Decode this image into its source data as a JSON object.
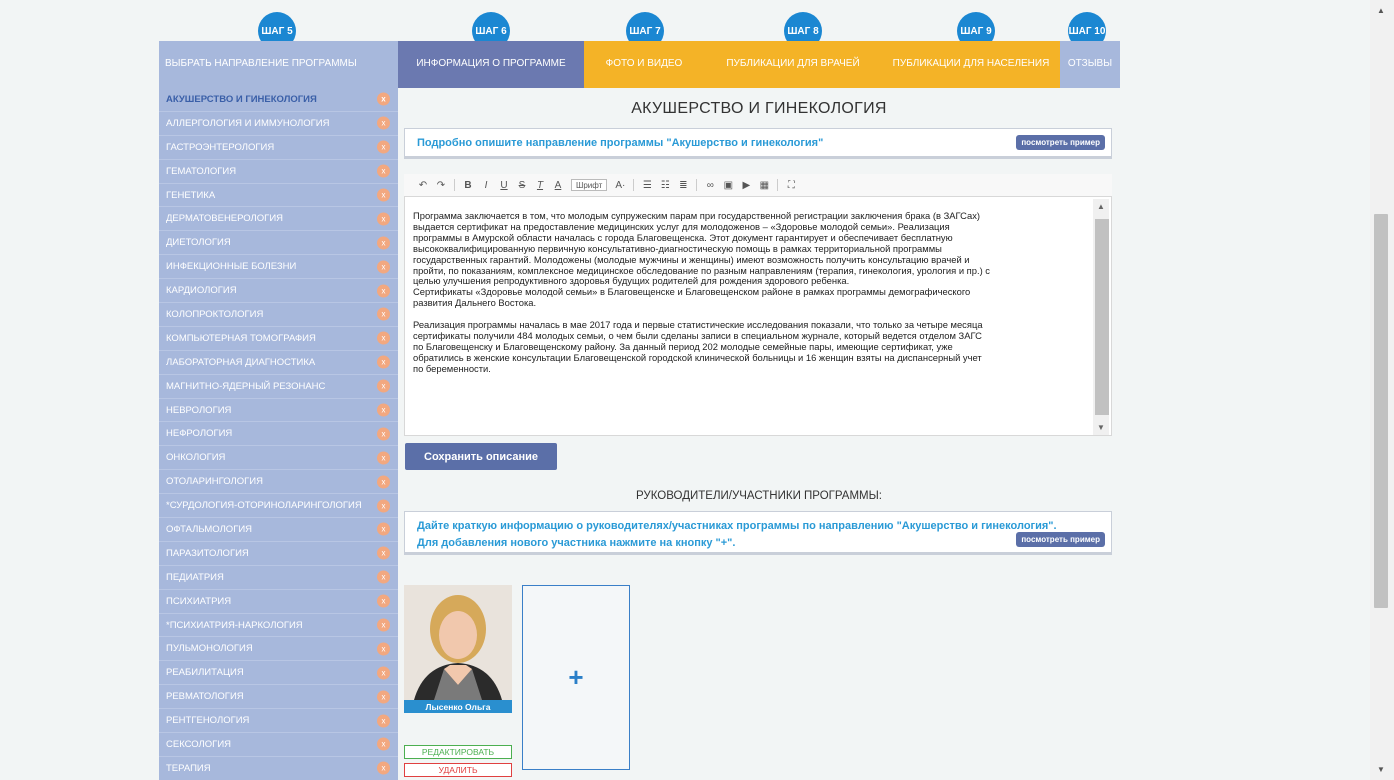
{
  "steps": [
    {
      "label": "ШАГ 5"
    },
    {
      "label": "ШАГ 6"
    },
    {
      "label": "ШАГ 7"
    },
    {
      "label": "ШАГ 8"
    },
    {
      "label": "ШАГ 9"
    },
    {
      "label": "ШАГ 10"
    }
  ],
  "step_bars": {
    "choose_direction": "ВЫБРАТЬ НАПРАВЛЕНИЕ ПРОГРАММЫ",
    "program_info": "ИНФОРМАЦИЯ О ПРОГРАММЕ",
    "photo_video": "ФОТО И ВИДЕО",
    "pub_doctors": "ПУБЛИКАЦИИ ДЛЯ ВРАЧЕЙ",
    "pub_population": "ПУБЛИКАЦИИ ДЛЯ НАСЕЛЕНИЯ",
    "reviews": "ОТЗЫВЫ"
  },
  "sidebar": {
    "items": [
      "АКУШЕРСТВО И ГИНЕКОЛОГИЯ",
      "АЛЛЕРГОЛОГИЯ И ИММУНОЛОГИЯ",
      "ГАСТРОЭНТЕРОЛОГИЯ",
      "ГЕМАТОЛОГИЯ",
      "ГЕНЕТИКА",
      "ДЕРМАТОВЕНЕРОЛОГИЯ",
      "ДИЕТОЛОГИЯ",
      "ИНФЕКЦИОННЫЕ БОЛЕЗНИ",
      "КАРДИОЛОГИЯ",
      "КОЛОПРОКТОЛОГИЯ",
      "КОМПЬЮТЕРНАЯ ТОМОГРАФИЯ",
      "ЛАБОРАТОРНАЯ ДИАГНОСТИКА",
      "МАГНИТНО-ЯДЕРНЫЙ РЕЗОНАНС",
      "НЕВРОЛОГИЯ",
      "НЕФРОЛОГИЯ",
      "ОНКОЛОГИЯ",
      "ОТОЛАРИНГОЛОГИЯ",
      "*СУРДОЛОГИЯ-ОТОРИНОЛАРИНГОЛОГИЯ",
      "ОФТАЛЬМОЛОГИЯ",
      "ПАРАЗИТОЛОГИЯ",
      "ПЕДИАТРИЯ",
      "ПСИХИАТРИЯ",
      "*ПСИХИАТРИЯ-НАРКОЛОГИЯ",
      "ПУЛЬМОНОЛОГИЯ",
      "РЕАБИЛИТАЦИЯ",
      "РЕВМАТОЛОГИЯ",
      "РЕНТГЕНОЛОГИЯ",
      "СЕКСОЛОГИЯ",
      "ТЕРАПИЯ"
    ],
    "remove_glyph": "x"
  },
  "main": {
    "title": "АКУШЕРСТВО И ГИНЕКОЛОГИЯ",
    "hint_description": "Подробно опишите направление программы \"Акушерство и гинекология\"",
    "example_label": "посмотреть пример",
    "toolbar": {
      "font_label": "Шрифт",
      "size_label": "A·"
    },
    "editor_text": "Программа заключается в том, что молодым супружеским парам при государственной регистрации заключения брака (в ЗАГСах)\nвыдается сертификат на предоставление медицинских услуг для молодоженов – «Здоровье молодой семьи». Реализация\nпрограммы в Амурской области началась с города Благовещенска. Этот документ гарантирует и обеспечивает бесплатную\nвысококвалифицированную первичную консультативно-диагностическую помощь в рамках территориальной программы\nгосударственных гарантий. Молодожены (молодые мужчины и женщины) имеют возможность получить консультацию врачей и\nпройти, по показаниям, комплексное медицинское обследование по разным направлениям (терапия, гинекология, урология и пр.) с\nцелью улучшения репродуктивного здоровья будущих родителей для рождения здорового ребенка.\nСертификаты «Здоровье молодой семьи» в Благовещенске и Благовещенском районе в рамках программы демографического\nразвития Дальнего Востока.\n\nРеализация программы началась в мае 2017 года и первые статистические исследования показали, что только за четыре месяца\nсертификаты получили 484 молодых семьи, о чем были сделаны записи в специальном журнале, который ведется отделом ЗАГС\nпо Благовещенску и Благовещенскому району. За данный период 202 молодые семейные пары, имеющие сертификат, уже\nобратились в женские консультации Благовещенской городской клинической больницы и 16 женщин взяты на диспансерный учет\nпо беременности.",
    "save_label": "Сохранить описание",
    "section_title": "РУКОВОДИТЕЛИ/УЧАСТНИКИ ПРОГРАММЫ:",
    "hint_members": "Дайте краткую информацию о руководителях/участниках программы по направлению \"Акушерство и гинекология\".\nДля добавления нового участника нажмите на кнопку \"+\".",
    "member": {
      "name": "Лысенко Ольга Викторовна",
      "edit_label": "РЕДАКТИРОВАТЬ",
      "delete_label": "УДАЛИТЬ"
    },
    "add_label": "+"
  },
  "colors": {
    "step_circle": "#1b87d2",
    "bar_light": "#a7b8dc",
    "bar_active": "#6b79b0",
    "bar_orange": "#f4b327",
    "hint_text": "#2a9ad6",
    "button": "#5b6fa8"
  }
}
